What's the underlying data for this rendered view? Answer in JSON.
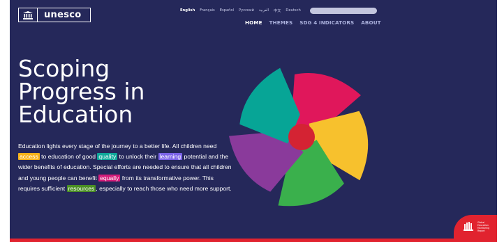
{
  "header": {
    "logo_text": "unesco",
    "languages": [
      "English",
      "Français",
      "Español",
      "Русский",
      "العربية",
      "中文",
      "Deutsch"
    ],
    "search_placeholder": "",
    "nav": [
      {
        "label": "HOME",
        "active": true
      },
      {
        "label": "THEMES",
        "active": false
      },
      {
        "label": "SDG 4 INDICATORS",
        "active": false
      },
      {
        "label": "ABOUT",
        "active": false
      }
    ]
  },
  "hero": {
    "title": "Scoping\nProgress in\nEducation",
    "body": {
      "t1": "Education lights every stage of the journey to a better life. All children need ",
      "access": "access",
      "t2": " to education of good ",
      "quality": "quality",
      "t3": " to unlock their ",
      "learning": "learning",
      "t4": " potential and the wider benefits of education. Special efforts are needed to ensure that all children and young people can benefit ",
      "equally": "equally",
      "t5": " from its transformative power. This requires sufficient ",
      "resources": "resources",
      "t6": ", especially to reach those who need more support."
    }
  },
  "badge": {
    "lines": [
      "Global",
      "Education",
      "Monitoring",
      "Report"
    ]
  },
  "colors": {
    "background": "#25285a",
    "accent_red": "#e1232f",
    "highlight_access": "#f5b21a",
    "highlight_quality": "#0fa79a",
    "highlight_learning": "#7b63e7",
    "highlight_equally": "#d41c7a",
    "highlight_resources": "#4a8e24"
  },
  "icons": {
    "logo": "temple-icon",
    "graphic": "shutter-circle-icon",
    "badge": "hands-icon"
  }
}
